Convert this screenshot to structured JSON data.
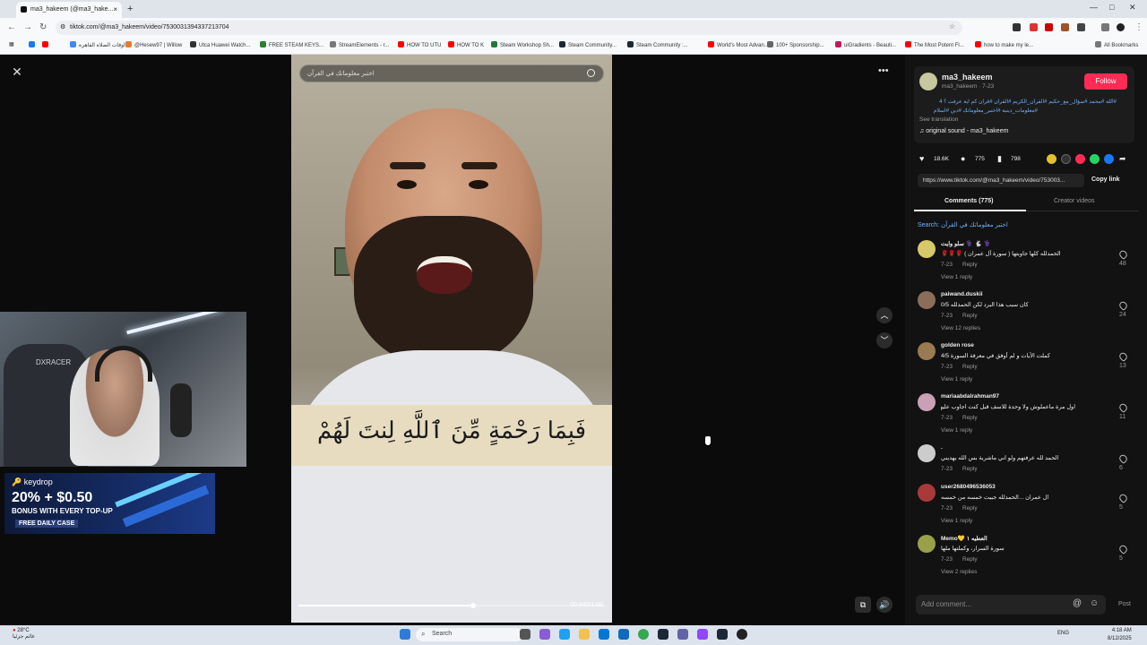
{
  "browser": {
    "tab_title": "ma3_hakeem (@ma3_hake...",
    "url": "tiktok.com/@ma3_hakeem/video/7530031394337213704",
    "bookmarks": [
      {
        "label": "اوقات الصلاة القاهرة",
        "color": "#4285f4"
      },
      {
        "label": "@Hesew97 | Willow",
        "color": "#e77b2f"
      },
      {
        "label": "Utca Huawei Watch...",
        "color": "#333333"
      },
      {
        "label": "FREE STEAM KEYS...",
        "color": "#2e7d32"
      },
      {
        "label": "StreamElements - r...",
        "color": "#777777"
      },
      {
        "label": "HOW TO UTU",
        "color": "#ff0000"
      },
      {
        "label": "HOW TO K",
        "color": "#ff0000"
      },
      {
        "label": "Steam Workshop Sh...",
        "color": "#1f7a3a"
      },
      {
        "label": "Steam Community...",
        "color": "#1b2838"
      },
      {
        "label": "Steam Community :...",
        "color": "#1b2838"
      },
      {
        "label": "World's Most Advan...",
        "color": "#ff0000"
      },
      {
        "label": "100+ Sponsorship...",
        "color": "#666666"
      },
      {
        "label": "uiGradients - Beauti...",
        "color": "#c2185b"
      },
      {
        "label": "The Most Potent Fl...",
        "color": "#ff0000"
      },
      {
        "label": "how to make my le...",
        "color": "#ff0000"
      }
    ],
    "all_bookmarks": "All Bookmarks"
  },
  "video": {
    "search_placeholder": "اختبر معلوماتك في القرآن",
    "caption": "فَبِمَا رَحْمَةٍ مِّنَ ٱللَّهِ لِنتَ لَهُمْ",
    "timecode": "00:44/01:08",
    "progress": 0.56
  },
  "ad": {
    "brand": "keydrop",
    "promo": "20% + $0.50",
    "subtitle": "BONUS WITH EVERY TOP-UP",
    "free": "FREE DAILY CASE"
  },
  "post": {
    "username": "ma3_hakeem",
    "handle_date": "ma3_hakeem · 7-23",
    "follow": "Follow",
    "description_line1": "#الله #محمد #سؤال_مع_حكيم #القرآن_الكريم #القرآن #قرآن كم آية عرفت ؟ 4",
    "description_line2": "#معلومات_دينية #اختبر_معلوماتك #دين #اسلام",
    "see_translation": "See translation",
    "sound": "original sound - ma3_hakeem",
    "likes": "18.6K",
    "comments": "775",
    "saves": "798",
    "link": "https://www.tiktok.com/@ma3_hakeem/video/753003...",
    "copy_link": "Copy link",
    "tab_comments": "Comments (775)",
    "tab_creator": "Creator videos",
    "search_label": "Search:",
    "search_term": "اختبر معلوماتك في القرآن"
  },
  "comments": [
    {
      "name": "سلو وايت ⚕️ 🐇 ⚕️",
      "text": "الحمدلله كلها جاوبتها ( سورة آل عمران ) 🌹🌹🌹",
      "date": "7-23",
      "reply": "Reply",
      "likes": "48",
      "replies": "View 1 reply",
      "avatar": "#d7c96a"
    },
    {
      "name": "paiwand.duskii",
      "text": "كان سبب هذا البرد لكن الحمدلله 0/5",
      "date": "7-23",
      "reply": "Reply",
      "likes": "24",
      "replies": "View 12 replies",
      "avatar": "#8b6e5a"
    },
    {
      "name": "golden rose",
      "text": "كملت الآيات و لم أوفق في معرفة السورة 4/5",
      "date": "7-23",
      "reply": "Reply",
      "likes": "13",
      "replies": "View 1 reply",
      "avatar": "#9a7a50"
    },
    {
      "name": "mariaabdalrahman97",
      "text": "اول مرة ماعملوش ولا وحدة للاسف قبل كنت اجاوب عليهم كلهم 😢",
      "date": "7-23",
      "reply": "Reply",
      "likes": "11",
      "replies": "View 1 reply",
      "avatar": "#c9a0b5"
    },
    {
      "name": ".",
      "text": "الحمد لله عرفتهم ولو اني ماشربة بس الله يهديني",
      "date": "7-23",
      "reply": "Reply",
      "likes": "6",
      "replies": "",
      "avatar": "#cccccc"
    },
    {
      "name": "user2680496536053",
      "text": "ال عمران ...الحمدلله جبيت خمسه من خمسه",
      "date": "7-23",
      "reply": "Reply",
      "likes": "5",
      "replies": "View 1 reply",
      "avatar": "#a83a3a"
    },
    {
      "name": "Memo💛 العطيه ١",
      "text": "سورة السرار، وكملتها ملها",
      "date": "7-23",
      "reply": "Reply",
      "likes": "5",
      "replies": "View 2 replies",
      "avatar": "#9aa04a"
    }
  ],
  "composer": {
    "placeholder": "Add comment...",
    "post": "Post"
  },
  "taskbar": {
    "temp": "28°C",
    "weather": "غائم جزئيا",
    "search": "Search",
    "lang": "ENG",
    "time": "4:18 AM",
    "date": "8/12/2025"
  },
  "webcam": {
    "chair_brand": "DXRACER"
  }
}
